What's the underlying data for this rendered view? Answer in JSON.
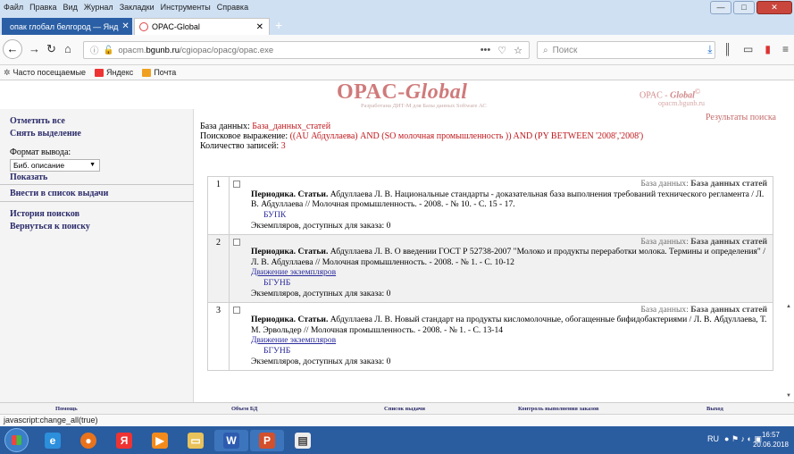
{
  "browser": {
    "menu": [
      "Файл",
      "Правка",
      "Вид",
      "Журнал",
      "Закладки",
      "Инструменты",
      "Справка"
    ],
    "tabs": [
      {
        "label": "опак глобал белгород — Янд",
        "active": false
      },
      {
        "label": "OPAC-Global",
        "active": true
      }
    ],
    "url_prefix": "opacm.",
    "url_domain": "bgunb.ru",
    "url_path": "/cgiopac/opacg/opac.exe",
    "url_more": "•••",
    "search_placeholder": "Поиск",
    "bookmarks": [
      "Часто посещаемые",
      "Яндекс",
      "Почта"
    ]
  },
  "header": {
    "logo_main": "OPAC-",
    "logo_italic": "Global",
    "logo_sub": "Разработана ДИТ-М для Базы данных Software АС",
    "brand_text": "OPAC - ",
    "brand_italic": "Global",
    "brand_sup": "©",
    "brand_sub": "opacm.bgunb.ru"
  },
  "sidebar": {
    "select_all": "Отметить все",
    "deselect": "Снять выделение",
    "format_label": "Формат вывода:",
    "format_value": "Биб. описание",
    "show": "Показать",
    "add_to_list": "Внести в список выдачи",
    "history": "История поисков",
    "back": "Вернуться к поиску"
  },
  "main": {
    "results_title": "Результаты поиска",
    "db_label": "База данных: ",
    "db_value": "База_данных_статей",
    "query_label": "Поисковое выражение: ",
    "query_value": "((AU Абдуллаева) AND (SO молочная промышленность )) AND (PY BETWEEN '2008','2008')",
    "count_label": "Количество записей: ",
    "count_value": "3",
    "records": [
      {
        "num": "1",
        "db_label": "База данных: ",
        "db_value": "База данных статей",
        "type": "Периодика. Статьи.",
        "text": " Абдуллаева Л. В. Национальные стандарты - доказательная база выполнения требований технического регламента / Л. В. Абдуллаева // Молочная промышленность. - 2008. - № 10. - С. 15 - 17.",
        "link": "",
        "library": "БУПК",
        "copies": "Экземпляров, доступных для заказа: 0"
      },
      {
        "num": "2",
        "db_label": "База данных: ",
        "db_value": "База данных статей",
        "type": "Периодика. Статьи.",
        "text": " Абдуллаева Л. В. О введении ГОСТ Р 52738-2007 \"Молоко и продукты переработки молока. Термины и определения\" / Л. В. Абдуллаева // Молочная промышленность. - 2008. - № 1. - С. 10-12",
        "link": "Движение экземпляров",
        "library": "БГУНБ",
        "copies": "Экземпляров, доступных для заказа: 0"
      },
      {
        "num": "3",
        "db_label": "База данных: ",
        "db_value": "База данных статей",
        "type": "Периодика. Статьи.",
        "text": " Абдуллаева Л. В. Новый стандарт на продукты кисломолочные, обогащенные бифидобактериями / Л. В. Абдуллаева, Т. М. Эрвольдер // Молочная промышленность. - 2008. - № 1. - С. 13-14",
        "link": "Движение экземпляров",
        "library": "БГУНБ",
        "copies": "Экземпляров, доступных для заказа: 0"
      }
    ]
  },
  "footer": [
    "Помощь",
    "Объем БД",
    "Список выдачи",
    "Контроль выполнения заказов",
    "Выход"
  ],
  "status": "javascript:change_all(true)",
  "taskbar": {
    "lang": "RU",
    "time": "16:57",
    "date": "20.06.2018"
  },
  "colors": {
    "accent": "#c0181c",
    "link": "#2b2b9c",
    "tab_active": "#2a5fa5",
    "taskbar": "#2a5ca0"
  }
}
